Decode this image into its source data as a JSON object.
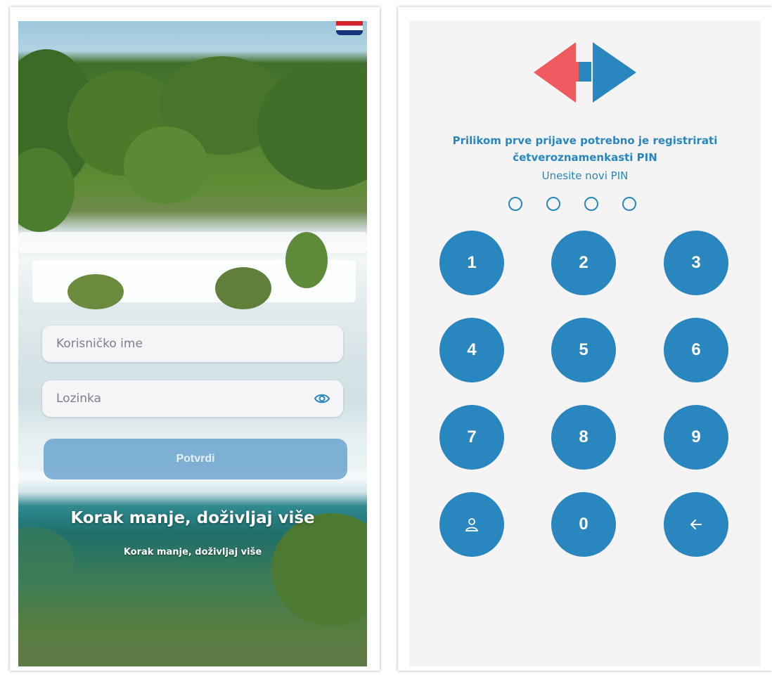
{
  "login": {
    "username_placeholder": "Korisničko ime",
    "password_placeholder": "Lozinka",
    "confirm_label": "Potvrdi",
    "tagline_big": "Korak manje, doživljaj više",
    "tagline_small": "Korak manje, doživljaj više",
    "language_flag": "croatia-flag-icon"
  },
  "pin": {
    "title_line1": "Prilikom prve prijave potrebno je registrirati",
    "title_line2": "četveroznamenkasti PIN",
    "subtitle": "Unesite novi PIN",
    "digits_entered": 0,
    "keys": [
      "1",
      "2",
      "3",
      "4",
      "5",
      "6",
      "7",
      "8",
      "9",
      "",
      "0",
      ""
    ],
    "icons": {
      "left_bottom": "user-icon",
      "right_bottom": "back-arrow-icon"
    }
  },
  "colors": {
    "accent": "#2a86bf",
    "logo_red": "#ee5a5d",
    "logo_blue": "#2a86bf",
    "confirm_button": "#5496c8"
  }
}
